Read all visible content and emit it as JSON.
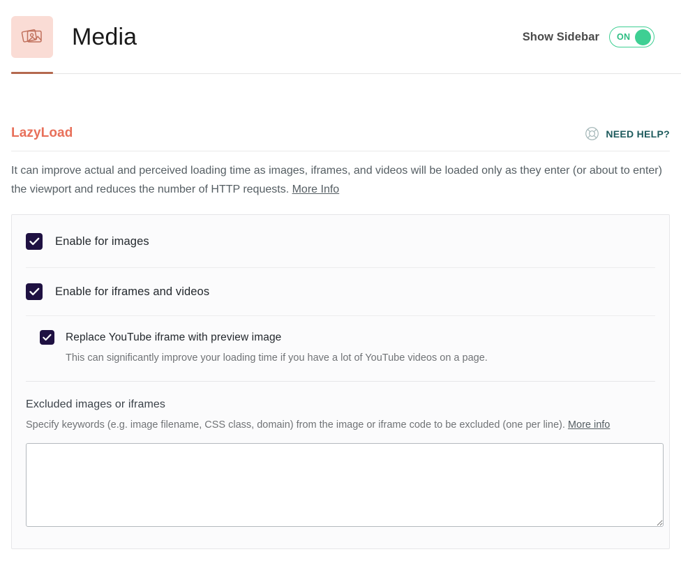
{
  "header": {
    "icon_name": "media-photos-icon",
    "title": "Media",
    "sidebar_toggle_label": "Show Sidebar",
    "toggle_state_text": "ON",
    "accent_pink": "#fadcd5",
    "tab_underline_color": "#b4694f",
    "toggle_green": "#3ecf93"
  },
  "section": {
    "title": "LazyLoad",
    "title_color": "#e8705a",
    "need_help_label": "NEED HELP?",
    "need_help_icon": "lifebuoy-icon",
    "need_help_color": "#1d5a5c",
    "description": "It can improve actual and perceived loading time as images, iframes, and videos will be loaded only as they enter (or about to enter) the viewport and reduces the number of HTTP requests.",
    "description_link": "More Info"
  },
  "settings": {
    "checkbox_color": "#1f1142",
    "images": {
      "label": "Enable for images",
      "checked": true
    },
    "iframes": {
      "label": "Enable for iframes and videos",
      "checked": true
    },
    "youtube": {
      "label": "Replace YouTube iframe with preview image",
      "description": "This can significantly improve your loading time if you have a lot of YouTube videos on a page.",
      "checked": true
    },
    "excluded": {
      "title": "Excluded images or iframes",
      "description": "Specify keywords (e.g. image filename, CSS class, domain) from the image or iframe code to be excluded (one per line).",
      "description_link": "More info",
      "textarea_value": "",
      "textarea_placeholder": ""
    }
  }
}
